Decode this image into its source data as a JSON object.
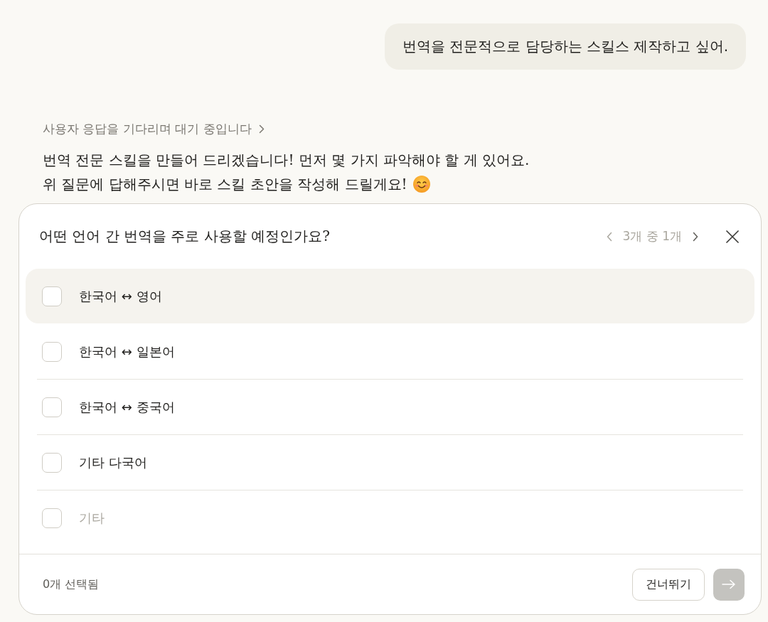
{
  "user_message": {
    "text": "번역을 전문적으로 담당하는 스킬스 제작하고 싶어."
  },
  "assistant": {
    "status": {
      "text": "사용자 응답을 기다리며 대기 중입니다",
      "expanded": false
    },
    "lines": [
      "번역 전문 스킬을 만들어 드리겠습니다! 먼저 몇 가지 파악해야 할 게 있어요.",
      "위 질문에 답해주시면 바로 스킬 초안을 작성해 드릴게요!"
    ]
  },
  "question_card": {
    "question": "어떤 언어 간 번역을 주로 사용할 예정인가요?",
    "pager": "3개 중 1개",
    "options": [
      {
        "kind": "choice",
        "label": "한국어 ↔ 영어",
        "checked": false,
        "hovered": true
      },
      {
        "kind": "choice",
        "label": "한국어 ↔ 일본어",
        "checked": false,
        "hovered": false
      },
      {
        "kind": "choice",
        "label": "한국어 ↔ 중국어",
        "checked": false,
        "hovered": false
      },
      {
        "kind": "choice",
        "label": "기타 다국어",
        "checked": false,
        "hovered": false
      },
      {
        "kind": "other",
        "placeholder": "기타",
        "checked": false,
        "hovered": false
      }
    ],
    "selected_count": "0개 선택됨",
    "skip_button": "건너뛰기",
    "next_button": {
      "disabled": true
    }
  }
}
